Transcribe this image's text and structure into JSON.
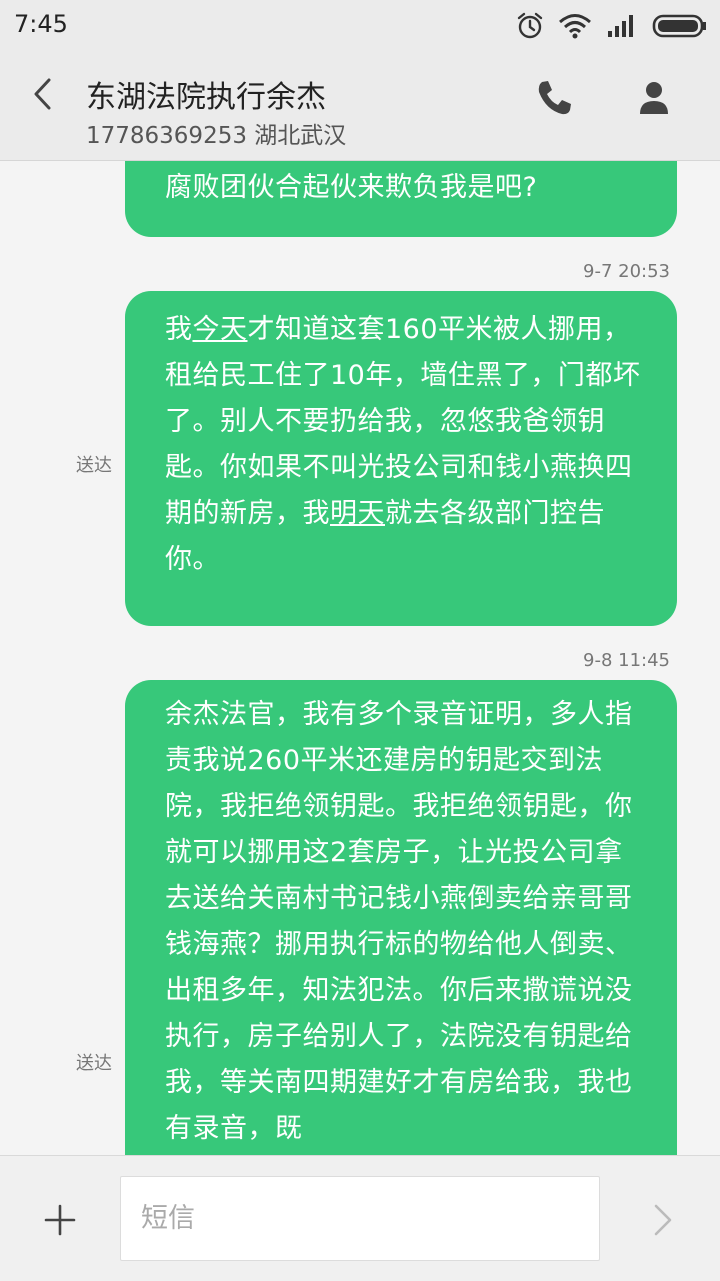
{
  "status_bar": {
    "time": "7:45",
    "icons": [
      "alarm-icon",
      "wifi-icon",
      "signal-icon",
      "battery-icon"
    ]
  },
  "header": {
    "contact_name": "东湖法院执行余杰",
    "contact_subtitle": "17786369253 湖北武汉",
    "icons": [
      "back-arrow-icon",
      "phone-icon",
      "person-icon"
    ]
  },
  "messages": [
    {
      "text": "腐败团伙合起伙来欺负我是吧?"
    },
    {
      "timestamp": "9-7 20:53",
      "status": "送达",
      "segments": [
        "我",
        "今天",
        "才知道这套160平米被人挪用，租给民工住了10年，墙住黑了，门都坏了。别人不要扔给我，忽悠我爸领钥匙。你如果不叫光投公司和钱小燕换四期的新房，我",
        "明天",
        "就去各级部门控告你。"
      ]
    },
    {
      "timestamp": "9-8 11:45",
      "status": "送达",
      "text": "余杰法官，我有多个录音证明，多人指责我说260平米还建房的钥匙交到法院，我拒绝领钥匙。我拒绝领钥匙，你就可以挪用这2套房子，让光投公司拿去送给关南村书记钱小燕倒卖给亲哥哥钱海燕？挪用执行标的物给他人倒卖、出租多年，知法犯法。你后来撒谎说没执行，房子给别人了，法院没有钥匙给我，等关南四期建好才有房给我，我也有录音，既"
    }
  ],
  "composer": {
    "placeholder": "短信",
    "icons": [
      "plus-icon",
      "send-icon"
    ]
  },
  "colors": {
    "bubble": "#37c87a",
    "header_bg": "#ebebeb",
    "page_bg": "#f4f4f4"
  }
}
